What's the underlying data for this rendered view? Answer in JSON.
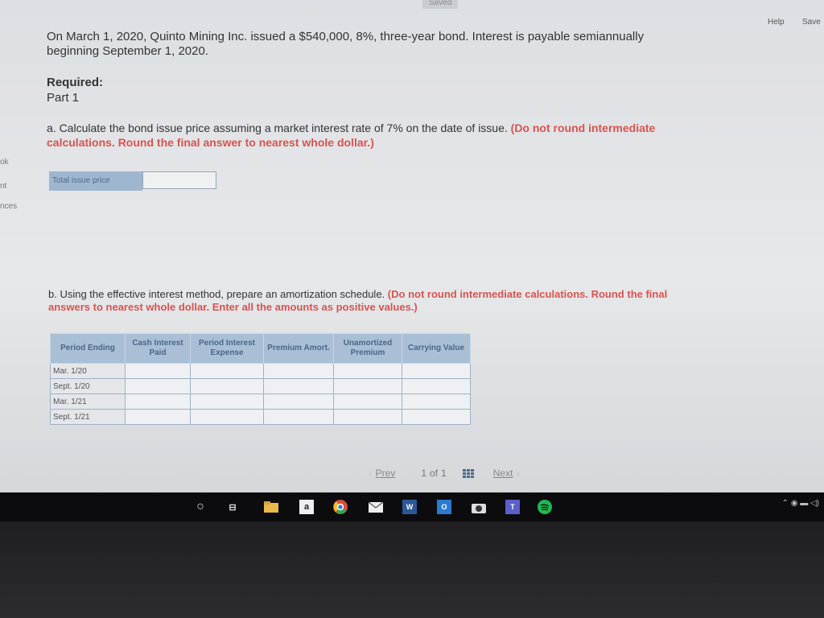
{
  "header": {
    "saved_label": "Saved",
    "help_label": "Help",
    "save_label": "Save"
  },
  "edge_labels": [
    "ok",
    "nt",
    "nces"
  ],
  "problem": {
    "text": "On March 1, 2020, Quinto Mining Inc. issued a $540,000, 8%, three-year bond. Interest is payable semiannually beginning September 1, 2020."
  },
  "required": {
    "heading": "Required:",
    "part": "Part 1"
  },
  "part_a": {
    "question": "a. Calculate the bond issue price assuming a market interest rate of 7% on the date of issue.",
    "instruction": "(Do not round intermediate calculations. Round the final answer to nearest whole dollar.)",
    "total_label": "Total issue price",
    "total_value": ""
  },
  "part_b": {
    "question": "b. Using the effective interest method, prepare an amortization schedule.",
    "instruction": "(Do not round intermediate calculations. Round the final answers to nearest whole dollar. Enter all the amounts as positive values.)"
  },
  "schedule": {
    "columns": [
      "Period Ending",
      "Cash Interest Paid",
      "Period Interest Expense",
      "Premium Amort.",
      "Unamortized Premium",
      "Carrying Value"
    ],
    "rows": [
      "Mar. 1/20",
      "Sept. 1/20",
      "Mar. 1/21",
      "Sept. 1/21"
    ]
  },
  "pagination": {
    "prev_label": "Prev",
    "current": "1",
    "of_label": "of",
    "total": "1",
    "next_label": "Next"
  },
  "taskbar": {
    "icons": [
      "cortana-circle-icon",
      "task-view-icon",
      "file-explorer-icon",
      "amazon-icon",
      "chrome-icon",
      "mail-icon",
      "word-icon",
      "outlook-icon",
      "camera-icon",
      "teams-icon",
      "spotify-icon"
    ]
  }
}
